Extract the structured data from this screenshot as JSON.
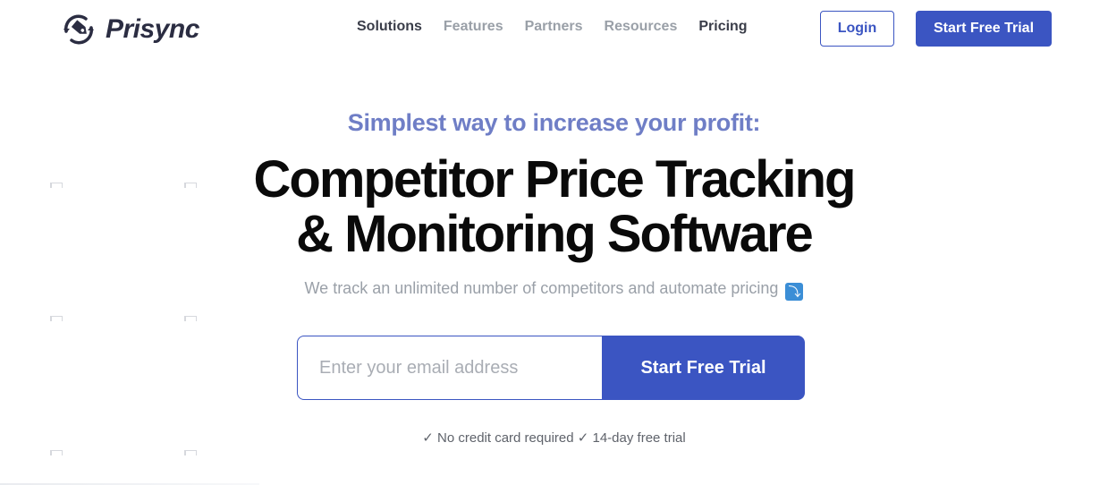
{
  "brand": {
    "name": "Prisync",
    "logo_icon": "price-tag-refresh-icon",
    "color": "#2b2d42"
  },
  "nav": {
    "items": [
      {
        "label": "Solutions",
        "emphasis": true
      },
      {
        "label": "Features",
        "emphasis": false
      },
      {
        "label": "Partners",
        "emphasis": false
      },
      {
        "label": "Resources",
        "emphasis": false
      },
      {
        "label": "Pricing",
        "emphasis": true
      }
    ]
  },
  "header_actions": {
    "login_label": "Login",
    "trial_label": "Start Free Trial"
  },
  "hero": {
    "tagline": "Simplest way to increase your profit:",
    "headline_line1": "Competitor Price Tracking",
    "headline_line2": "& Monitoring Software",
    "subtitle": "We track an unlimited number of competitors and automate pricing",
    "subtitle_icon": "arrow-down-right-icon",
    "email_placeholder": "Enter your email address",
    "cta_label": "Start Free Trial",
    "perk_1": "✓ No credit card required",
    "perk_2": "✓ 14-day free trial"
  },
  "colors": {
    "accent": "#3b55c2",
    "tagline": "#6f7ec6",
    "muted": "#9aa0a8"
  }
}
